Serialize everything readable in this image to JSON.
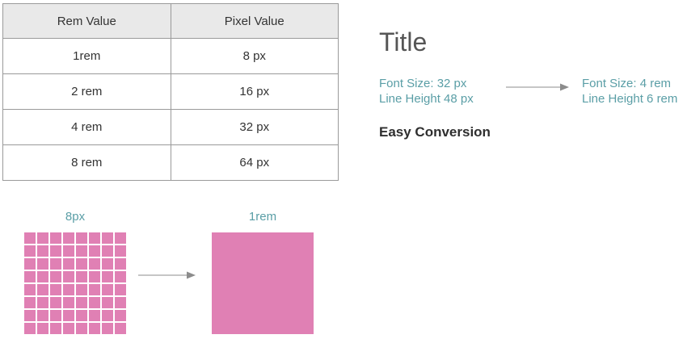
{
  "table": {
    "headers": [
      "Rem Value",
      "Pixel Value"
    ],
    "rows": [
      [
        "1rem",
        "8 px"
      ],
      [
        "2 rem",
        "16 px"
      ],
      [
        "4 rem",
        "32 px"
      ],
      [
        "8 rem",
        "64 px"
      ]
    ]
  },
  "title": "Title",
  "conversion": {
    "from": {
      "font_size": "Font Size: 32 px",
      "line_height": "Line Height 48 px"
    },
    "to": {
      "font_size": "Font Size: 4 rem",
      "line_height": "Line Height 6 rem"
    }
  },
  "easy_label": "Easy Conversion",
  "grid_label": "8px",
  "block_label": "1rem",
  "grid_cells": 64,
  "colors": {
    "accent_text": "#5a9ea6",
    "pink": "#e080b4",
    "arrow": "#8c8c8c"
  }
}
